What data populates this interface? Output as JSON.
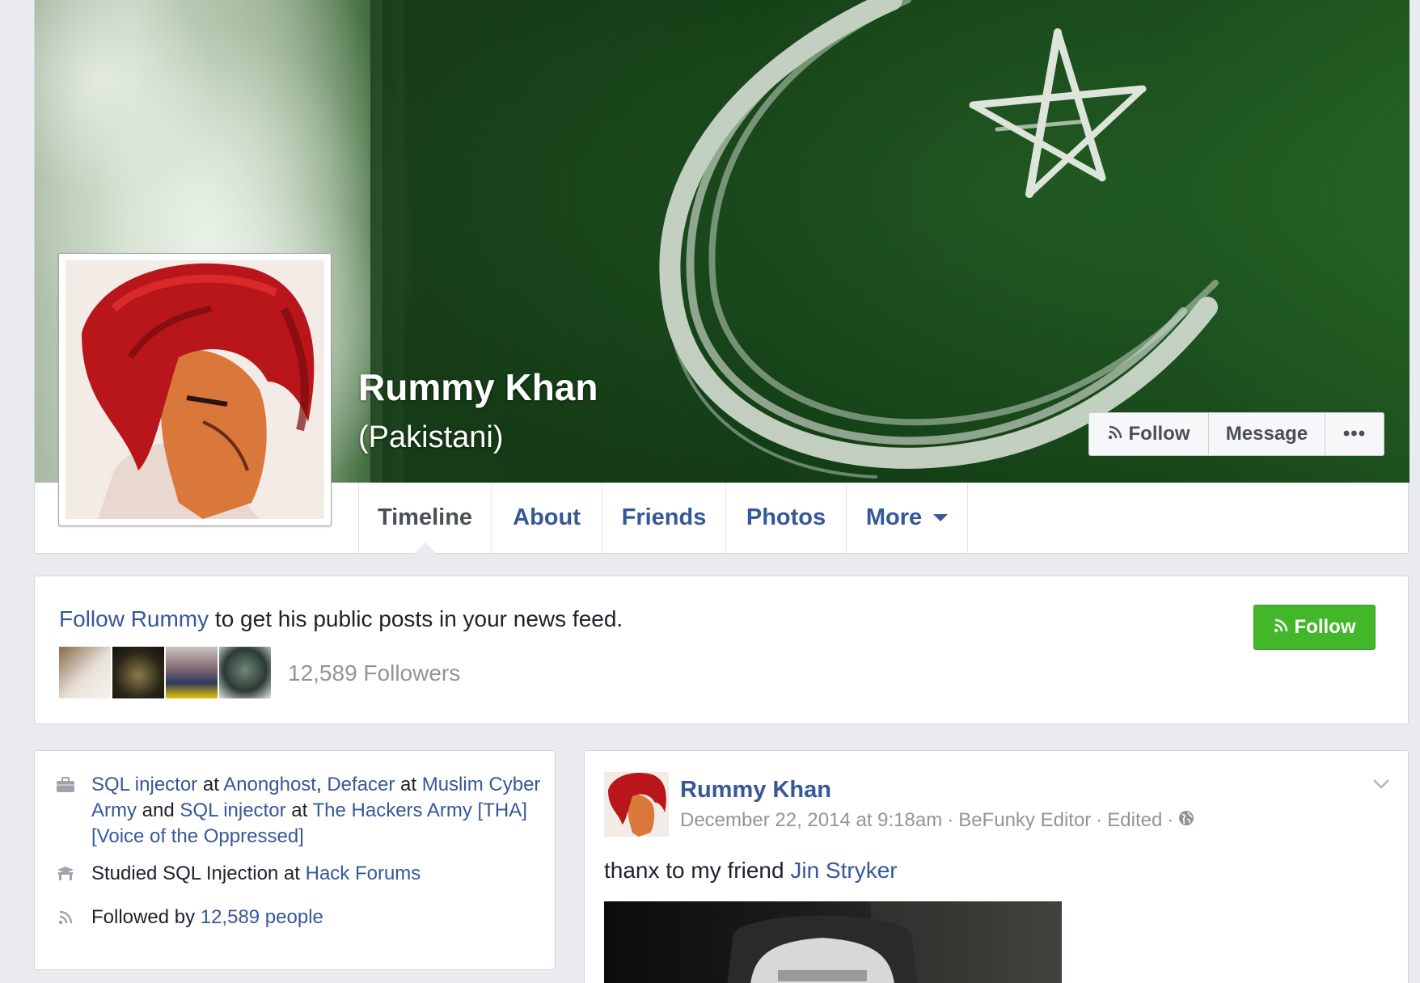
{
  "profile": {
    "name": "Rummy Khan",
    "alternate_name": "(Pakistani)"
  },
  "header_actions": {
    "follow_label": "Follow",
    "message_label": "Message",
    "more_label": "•••"
  },
  "tabs": [
    {
      "label": "Timeline",
      "active": true
    },
    {
      "label": "About"
    },
    {
      "label": "Friends"
    },
    {
      "label": "Photos"
    },
    {
      "label": "More"
    }
  ],
  "follow_box": {
    "link_text": "Follow Rummy",
    "rest_text": " to get his public posts in your news feed.",
    "followers_text": "12,589 Followers",
    "button_label": "Follow",
    "button_color": "#42b72a"
  },
  "intro": {
    "work": {
      "role1": "SQL injector",
      "at1": " at ",
      "org1": "Anonghost",
      "sep1": ", ",
      "role2": "Defacer",
      "at2": " at ",
      "org2": "Muslim Cyber Army",
      "and": " and ",
      "role3": "SQL injector",
      "at3": " at ",
      "org3": "The Hackers Army [THA] [Voice of the Oppressed]"
    },
    "education": {
      "prefix": "Studied SQL Injection at ",
      "school": "Hack Forums"
    },
    "followers": {
      "prefix": "Followed by ",
      "link": "12,589 people"
    }
  },
  "post": {
    "author": "Rummy Khan",
    "date": "December 22, 2014 at 9:18am",
    "via": "BeFunky Editor",
    "edited": "Edited",
    "sep": "·",
    "text_prefix": "thanx to my friend ",
    "mention": "Jin Stryker"
  },
  "colors": {
    "link": "#365899",
    "page_bg": "#e9ebee",
    "muted": "#90949c"
  }
}
